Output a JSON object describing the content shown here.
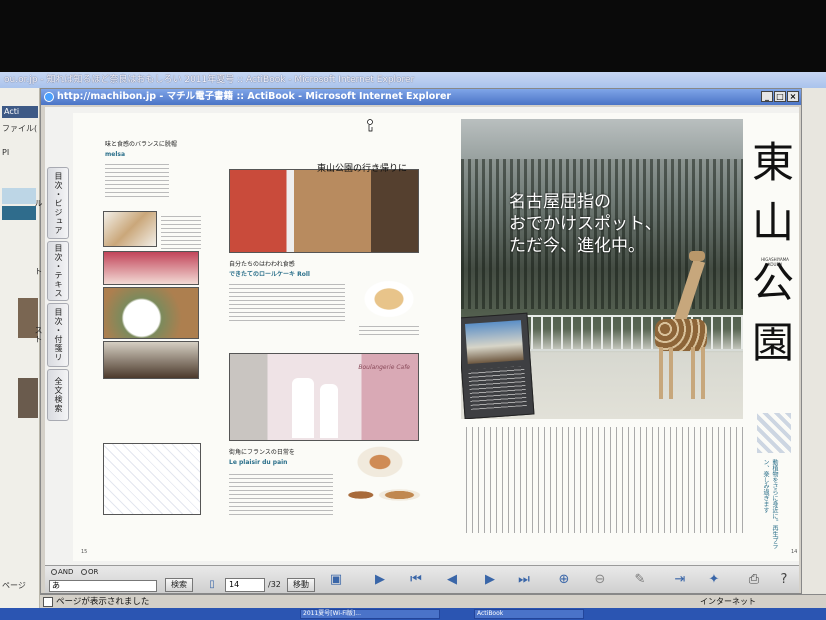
{
  "back_window": {
    "title": "ou.or.jp - 知れば知るほど奈良はおもしろい 2011年夏号 :: ActiBook - Microsoft Internet Explorer",
    "file_menu": "ファイル(",
    "side_item": "Acti",
    "side_label_1": "PI",
    "status_hint": "ページ"
  },
  "window": {
    "title": "http://machibon.jp - マチル電子書籍 :: ActiBook - Microsoft Internet Explorer",
    "buttons": [
      "_",
      "□",
      "×"
    ]
  },
  "nav_tabs": [
    "目次・ビジュアル",
    "目次・テキスト",
    "目次・付箋リスト",
    "全文検索"
  ],
  "left_page": {
    "header": "味と食感のバランスに脱帽",
    "shop1_name": "melsa",
    "shop2_heading": "自分たちのはわわれ食感",
    "shop2_name": "できたてのロールケーキ Roll",
    "shop3_heading": "街角にフランスの日常を",
    "shop3_name": "Le plaisir du pain",
    "bakery_sign": "Boulangerie Cafe",
    "page_number": "15"
  },
  "right_page": {
    "headline": "東山公園の行き帰りに",
    "catch_line_1": "名古屋屈指の",
    "catch_line_2": "おでかけスポット、",
    "catch_line_3": "ただ今、進化中。",
    "vertical_title": [
      "東",
      "山",
      "公",
      "園"
    ],
    "romaji": "HIGASHIYAMA KOUEN",
    "lead": "動植物をさらに身近に。再生プラン、楽しみ過ぎます",
    "page_number": "14"
  },
  "toolbar": {
    "and_label": "AND",
    "or_label": "OR",
    "search_value": "あ",
    "search_button": "検索",
    "current_page": "14",
    "total_pages": "/32",
    "go_button": "移動"
  },
  "status": {
    "text": "ページが表示されました",
    "zone": "インターネット"
  },
  "taskbar": {
    "items": [
      "2011夏号[Wi-Fi版]...",
      "ActiBook"
    ]
  }
}
